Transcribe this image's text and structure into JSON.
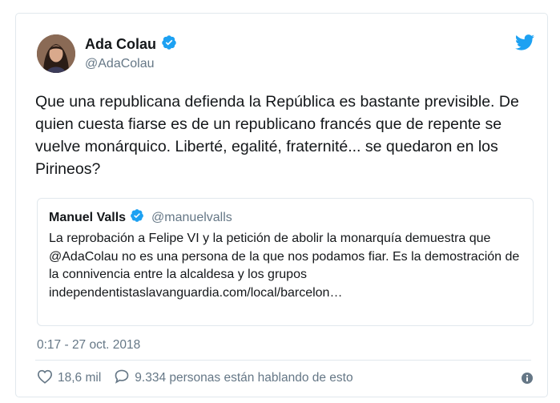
{
  "author": {
    "name": "Ada Colau",
    "handle": "@AdaColau",
    "verified": true
  },
  "tweet": {
    "text": "Que una republicana defienda la República es bastante previsible. De quien cuesta fiarse es de un republicano francés que de repente se vuelve monárquico. Liberté, egalité, fraternité... se quedaron en los Pirineos?"
  },
  "quoted": {
    "name": "Manuel Valls",
    "handle": "@manuelvalls",
    "verified": true,
    "text": "La reprobación a Felipe VI y la petición de abolir la monarquía demuestra que @AdaColau no es una persona de la que nos podamos fiar. Es la demostración de la connivencia entre la alcaldesa y los grupos independentistaslavanguardia.com/local/barcelon…"
  },
  "timestamp": "0:17 - 27 oct. 2018",
  "stats": {
    "likes": "18,6 mil",
    "conversation": "9.334 personas están hablando de esto"
  },
  "icons": {
    "brand": "twitter-bird-icon",
    "verified": "verified-badge-icon",
    "like": "heart-icon",
    "reply": "comment-bubble-icon",
    "info": "info-icon"
  },
  "colors": {
    "brand_blue": "#1da1f2",
    "muted_text": "#657786",
    "border": "#e1e8ed"
  }
}
